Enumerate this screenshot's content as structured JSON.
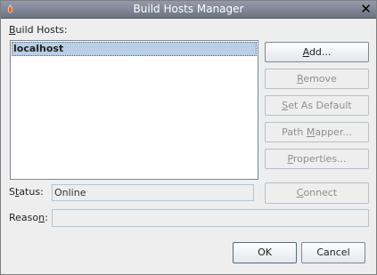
{
  "window": {
    "title": "Build Hosts Manager",
    "close_glyph": "✕"
  },
  "hosts": {
    "label_prefix": "",
    "label_mnemonic": "B",
    "label_rest": "uild Hosts:",
    "items": [
      {
        "name": "localhost",
        "selected": true
      }
    ]
  },
  "buttons": {
    "add": {
      "pre": "",
      "mn": "A",
      "post": "dd...",
      "enabled": true
    },
    "remove": {
      "pre": "",
      "mn": "R",
      "post": "emove",
      "enabled": false
    },
    "set_default": {
      "pre": "",
      "mn": "S",
      "post": "et As Default",
      "enabled": false
    },
    "path_mapper": {
      "pre": "Path ",
      "mn": "M",
      "post": "apper...",
      "enabled": false
    },
    "properties": {
      "pre": "",
      "mn": "P",
      "post": "roperties...",
      "enabled": false
    },
    "connect": {
      "pre": "",
      "mn": "C",
      "post": "onnect",
      "enabled": false
    },
    "ok": {
      "label": "OK",
      "enabled": true
    },
    "cancel": {
      "label": "Cancel",
      "enabled": true
    }
  },
  "status": {
    "label_pre": "S",
    "label_mn": "t",
    "label_post": "atus:",
    "value": "Online"
  },
  "reason": {
    "label_pre": "Reaso",
    "label_mn": "n",
    "label_post": ":",
    "value": ""
  }
}
